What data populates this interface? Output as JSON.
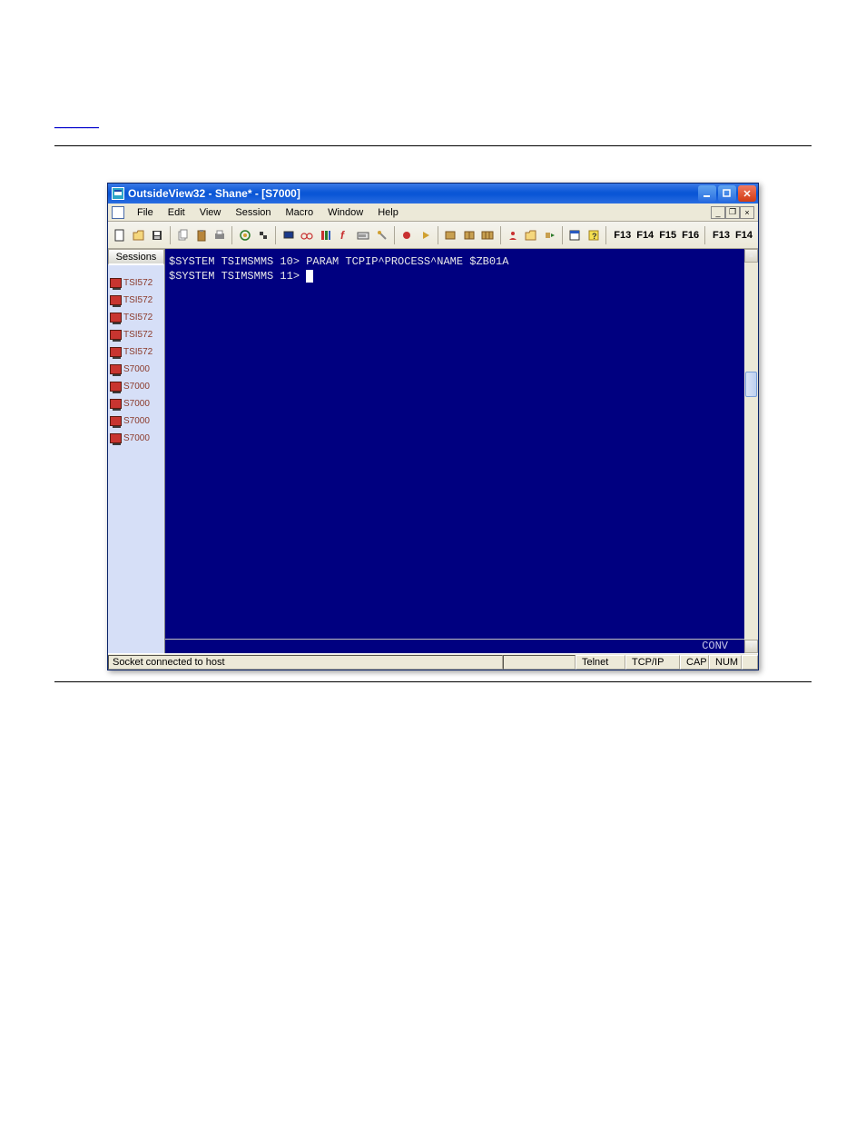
{
  "breadcrumb": "________",
  "window": {
    "title": "OutsideView32 - Shane* - [S7000]"
  },
  "menu": {
    "items": [
      "File",
      "Edit",
      "View",
      "Session",
      "Macro",
      "Window",
      "Help"
    ]
  },
  "toolbar": {
    "fkeys_left": [
      "F13",
      "F14",
      "F15",
      "F16"
    ],
    "fkeys_right": [
      "F13",
      "F14"
    ]
  },
  "sessions": {
    "header": "Sessions",
    "items": [
      {
        "label": "TSI572"
      },
      {
        "label": "TSI572"
      },
      {
        "label": "TSI572"
      },
      {
        "label": "TSI572"
      },
      {
        "label": "TSI572"
      },
      {
        "label": "S7000"
      },
      {
        "label": "S7000"
      },
      {
        "label": "S7000"
      },
      {
        "label": "S7000"
      },
      {
        "label": "S7000"
      }
    ]
  },
  "terminal": {
    "line1": "$SYSTEM TSIMSMMS 10> PARAM TCPIP^PROCESS^NAME $ZB01A",
    "line2": "$SYSTEM TSIMSMMS 11> ",
    "footer_mode": "CONV"
  },
  "status": {
    "message": "Socket connected to host",
    "protocol": "Telnet",
    "transport": "TCP/IP",
    "cap": "CAP",
    "num": "NUM"
  }
}
